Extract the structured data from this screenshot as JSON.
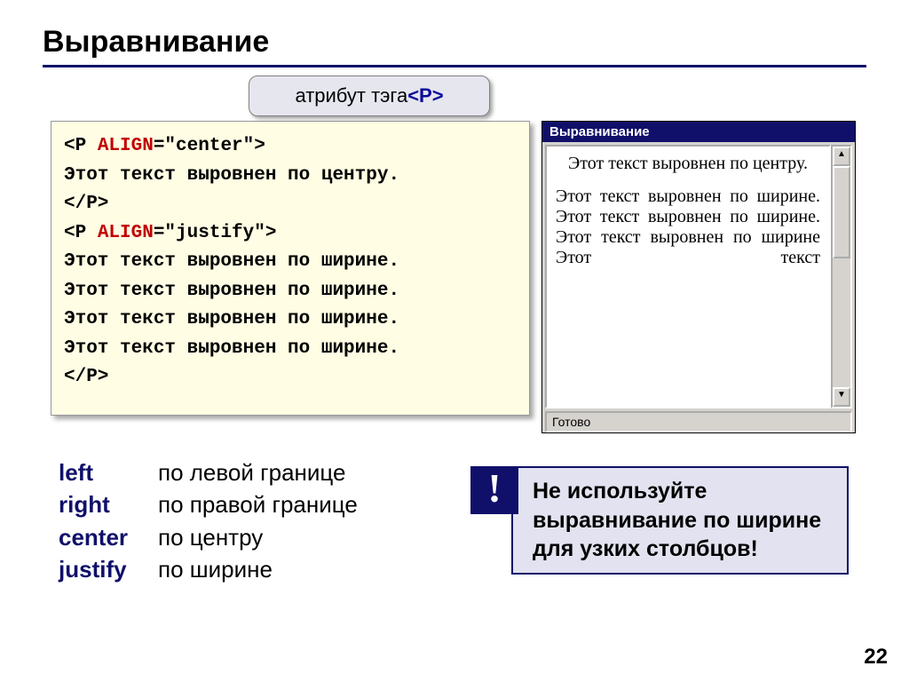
{
  "title": "Выравнивание",
  "callout": {
    "prefix": "атрибут тэга ",
    "tag": "<P>"
  },
  "code": {
    "l1_open": "<P ",
    "l1_attr": "ALIGN",
    "l1_rest": "=\"center\">",
    "l2": "Этот текст выровнен по центру.",
    "l3": "</P>",
    "l4_open": "<P ",
    "l4_attr": "ALIGN",
    "l4_rest": "=\"justify\">",
    "l5": "Этот текст выровнен по ширине.",
    "l6": "Этот текст выровнен по ширине.",
    "l7": "Этот текст выровнен по ширине.",
    "l8": "Этот текст выровнен по ширине.",
    "l9": "</P>"
  },
  "browser": {
    "title": "Выравнивание",
    "center_text": "Этот текст выровнен по центру.",
    "just_text": "Этот текст выровнен по ширине. Этот текст выровнен по ширине. Этот текст выровнен по ширине Этот текст",
    "status": "Готово"
  },
  "legend": {
    "left_k": "left",
    "left_v": "по левой границе",
    "right_k": "right",
    "right_v": "по правой границе",
    "center_k": "center",
    "center_v": "по центру",
    "justify_k": "justify",
    "justify_v": "по ширине"
  },
  "warning": {
    "bang": "!",
    "text": "Не используйте выравнивание по ширине для узких столбцов!"
  },
  "page_number": "22"
}
